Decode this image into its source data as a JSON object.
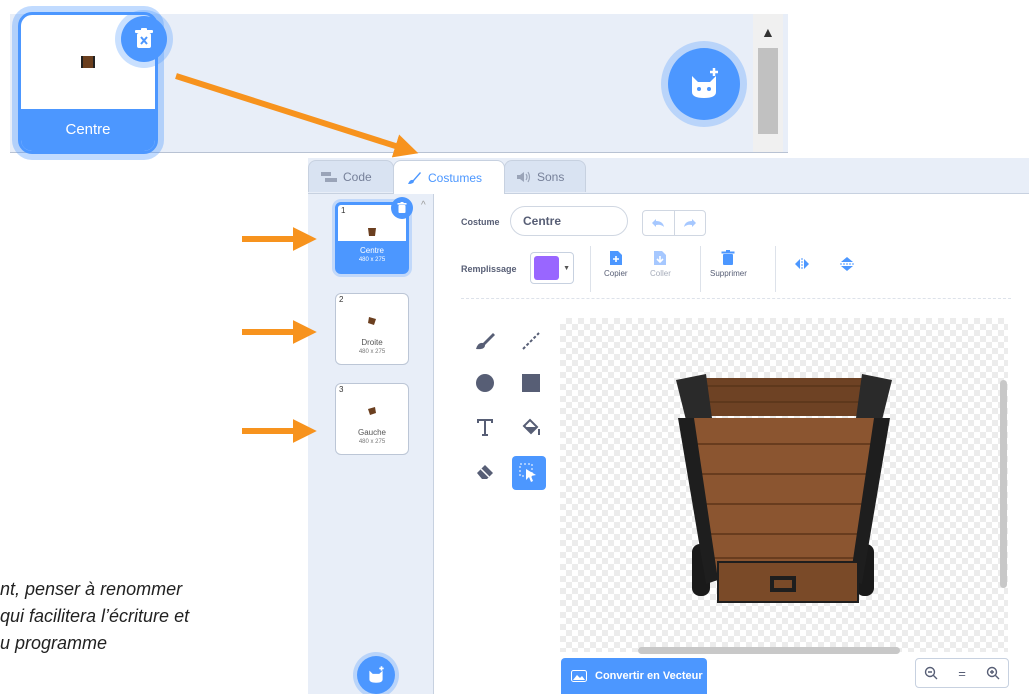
{
  "sprite_pane": {
    "sprite_name": "Centre"
  },
  "tabs": [
    {
      "label": "Code"
    },
    {
      "label": "Costumes"
    },
    {
      "label": "Sons"
    }
  ],
  "costumes": [
    {
      "number": "1",
      "name": "Centre",
      "size": "480 x 275"
    },
    {
      "number": "2",
      "name": "Droite",
      "size": "480 x 275"
    },
    {
      "number": "3",
      "name": "Gauche",
      "size": "480 x 275"
    }
  ],
  "toolbar": {
    "costume_label": "Costume",
    "costume_name": "Centre",
    "fill_label": "Remplissage",
    "fill_color": "#9966ff",
    "copy_label": "Copier",
    "paste_label": "Coller",
    "delete_label": "Supprimer"
  },
  "canvas": {
    "convert_label": "Convertir en Vecteur",
    "zoom_out": "−",
    "zoom_reset": "=",
    "zoom_in": "+"
  },
  "caption": {
    "line1": "nt, penser à renommer",
    "line2": "qui facilitera l’écriture et",
    "line3": "u programme"
  },
  "colors": {
    "accent": "#4c97ff",
    "arrow": "#f7931e",
    "cart_wood": "#8b5530",
    "cart_frame": "#1e1e1e"
  }
}
